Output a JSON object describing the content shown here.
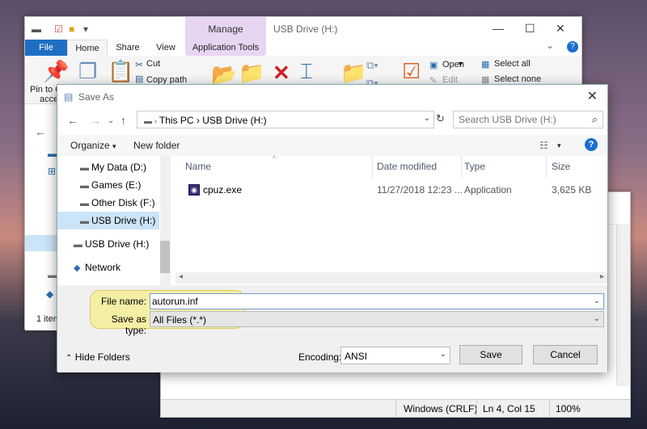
{
  "explorer": {
    "title": "USB Drive (H:)",
    "tabs": {
      "file": "File",
      "home": "Home",
      "share": "Share",
      "view": "View",
      "app_tools": "Application Tools",
      "manage": "Manage"
    },
    "ribbon": {
      "pin_to_quick": "Pin to Q",
      "access": "acce",
      "cut": "Cut",
      "copy_path": "Copy path",
      "open": "Open",
      "edit": "Edit",
      "select_all": "Select all",
      "select_none": "Select none"
    },
    "status": "1 item"
  },
  "notepad": {
    "status": {
      "eol": "Windows (CRLF)",
      "position": "Ln 4, Col 15",
      "zoom": "100%"
    }
  },
  "saveas": {
    "title": "Save As",
    "address": {
      "this_pc": "This PC",
      "drive": "USB Drive (H:)"
    },
    "search_placeholder": "Search USB Drive (H:)",
    "toolbar": {
      "organize": "Organize",
      "new_folder": "New folder"
    },
    "nav": [
      {
        "label": "My Data (D:)"
      },
      {
        "label": "Games (E:)"
      },
      {
        "label": "Other Disk (F:)"
      },
      {
        "label": "USB Drive (H:)"
      },
      {
        "label": "USB Drive (H:)"
      },
      {
        "label": "Network"
      }
    ],
    "columns": {
      "name": "Name",
      "date": "Date modified",
      "type": "Type",
      "size": "Size"
    },
    "files": [
      {
        "name": "cpuz.exe",
        "date": "11/27/2018 12:23 ...",
        "type": "Application",
        "size": "3,625 KB"
      }
    ],
    "form": {
      "file_name_label": "File name:",
      "file_name_value": "autorun.inf",
      "save_type_label": "Save as type:",
      "save_type_value": "All Files  (*.*)",
      "hide_folders": "Hide Folders",
      "encoding_label": "Encoding:",
      "encoding_value": "ANSI",
      "save": "Save",
      "cancel": "Cancel"
    }
  }
}
